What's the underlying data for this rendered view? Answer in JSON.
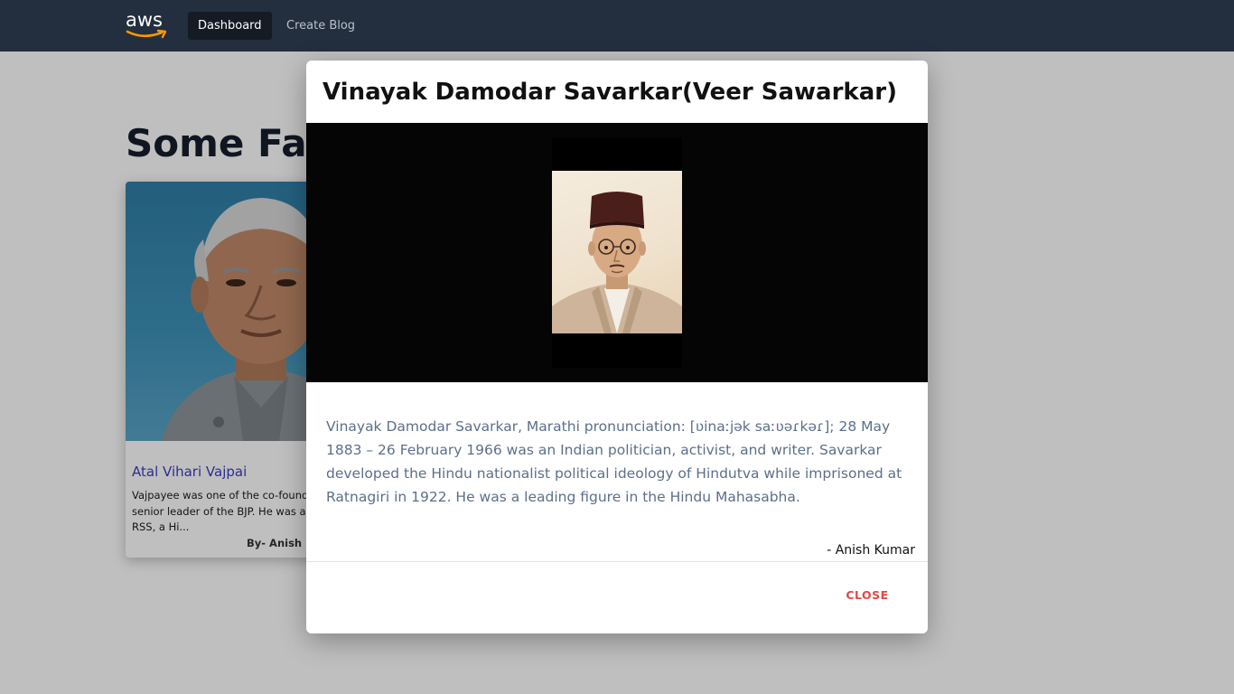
{
  "nav": {
    "logo_text": "aws",
    "items": [
      {
        "label": "Dashboard",
        "active": true
      },
      {
        "label": "Create Blog",
        "active": false
      }
    ]
  },
  "page": {
    "heading": "Some Famous",
    "cards": [
      {
        "title": "Atal Vihari Vajpai",
        "description": "Vajpayee was one of the co-founders and a senior leader of the BJP. He was a member of the RSS, a Hi...",
        "author": "By- Anish Kumar"
      }
    ]
  },
  "modal": {
    "title": "Vinayak Damodar Savarkar(Veer Sawarkar)",
    "body": "Vinayak Damodar Savarkar, Marathi pronunciation: [ʋinaːjək saːʋəɾkəɾ]; 28 May 1883 – 26 February 1966 was an Indian politician, activist, and writer. Savarkar developed the Hindu nationalist political ideology of Hindutva while imprisoned at Ratnagiri in 1922. He was a leading figure in the Hindu Mahasabha.",
    "author": "- Anish Kumar",
    "close_label": "CLOSE"
  },
  "colors": {
    "navbar": "#232f3e",
    "accent_close": "#e54646",
    "card_title": "#3c3cc2",
    "body_text": "#5d6f8a"
  }
}
